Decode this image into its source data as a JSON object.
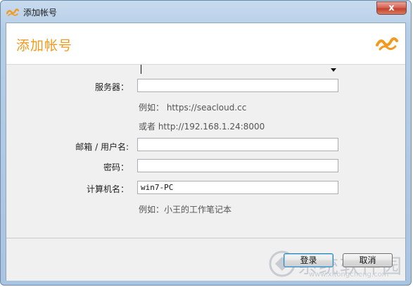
{
  "window": {
    "title": "添加帐号",
    "close_label": "x"
  },
  "header": {
    "title": "添加帐号"
  },
  "form": {
    "server": {
      "label": "服务器：",
      "value": ""
    },
    "hint1": "例如： https://seacloud.cc",
    "hint2": "或者 http://192.168.1.24:8000",
    "email": {
      "label": "邮箱 / 用户名:",
      "value": ""
    },
    "password": {
      "label": "密码：",
      "value": ""
    },
    "computer": {
      "label": "计算机名：",
      "value": "win7-PC"
    },
    "hint3": "例如：小王的工作笔记本"
  },
  "buttons": {
    "ok": "登录",
    "cancel": "取消"
  },
  "watermark": {
    "text": "系统软件园",
    "url": "www.xitongcheng.com"
  },
  "colors": {
    "accent": "#f29a1d",
    "titlebar": "#b6cde6"
  }
}
